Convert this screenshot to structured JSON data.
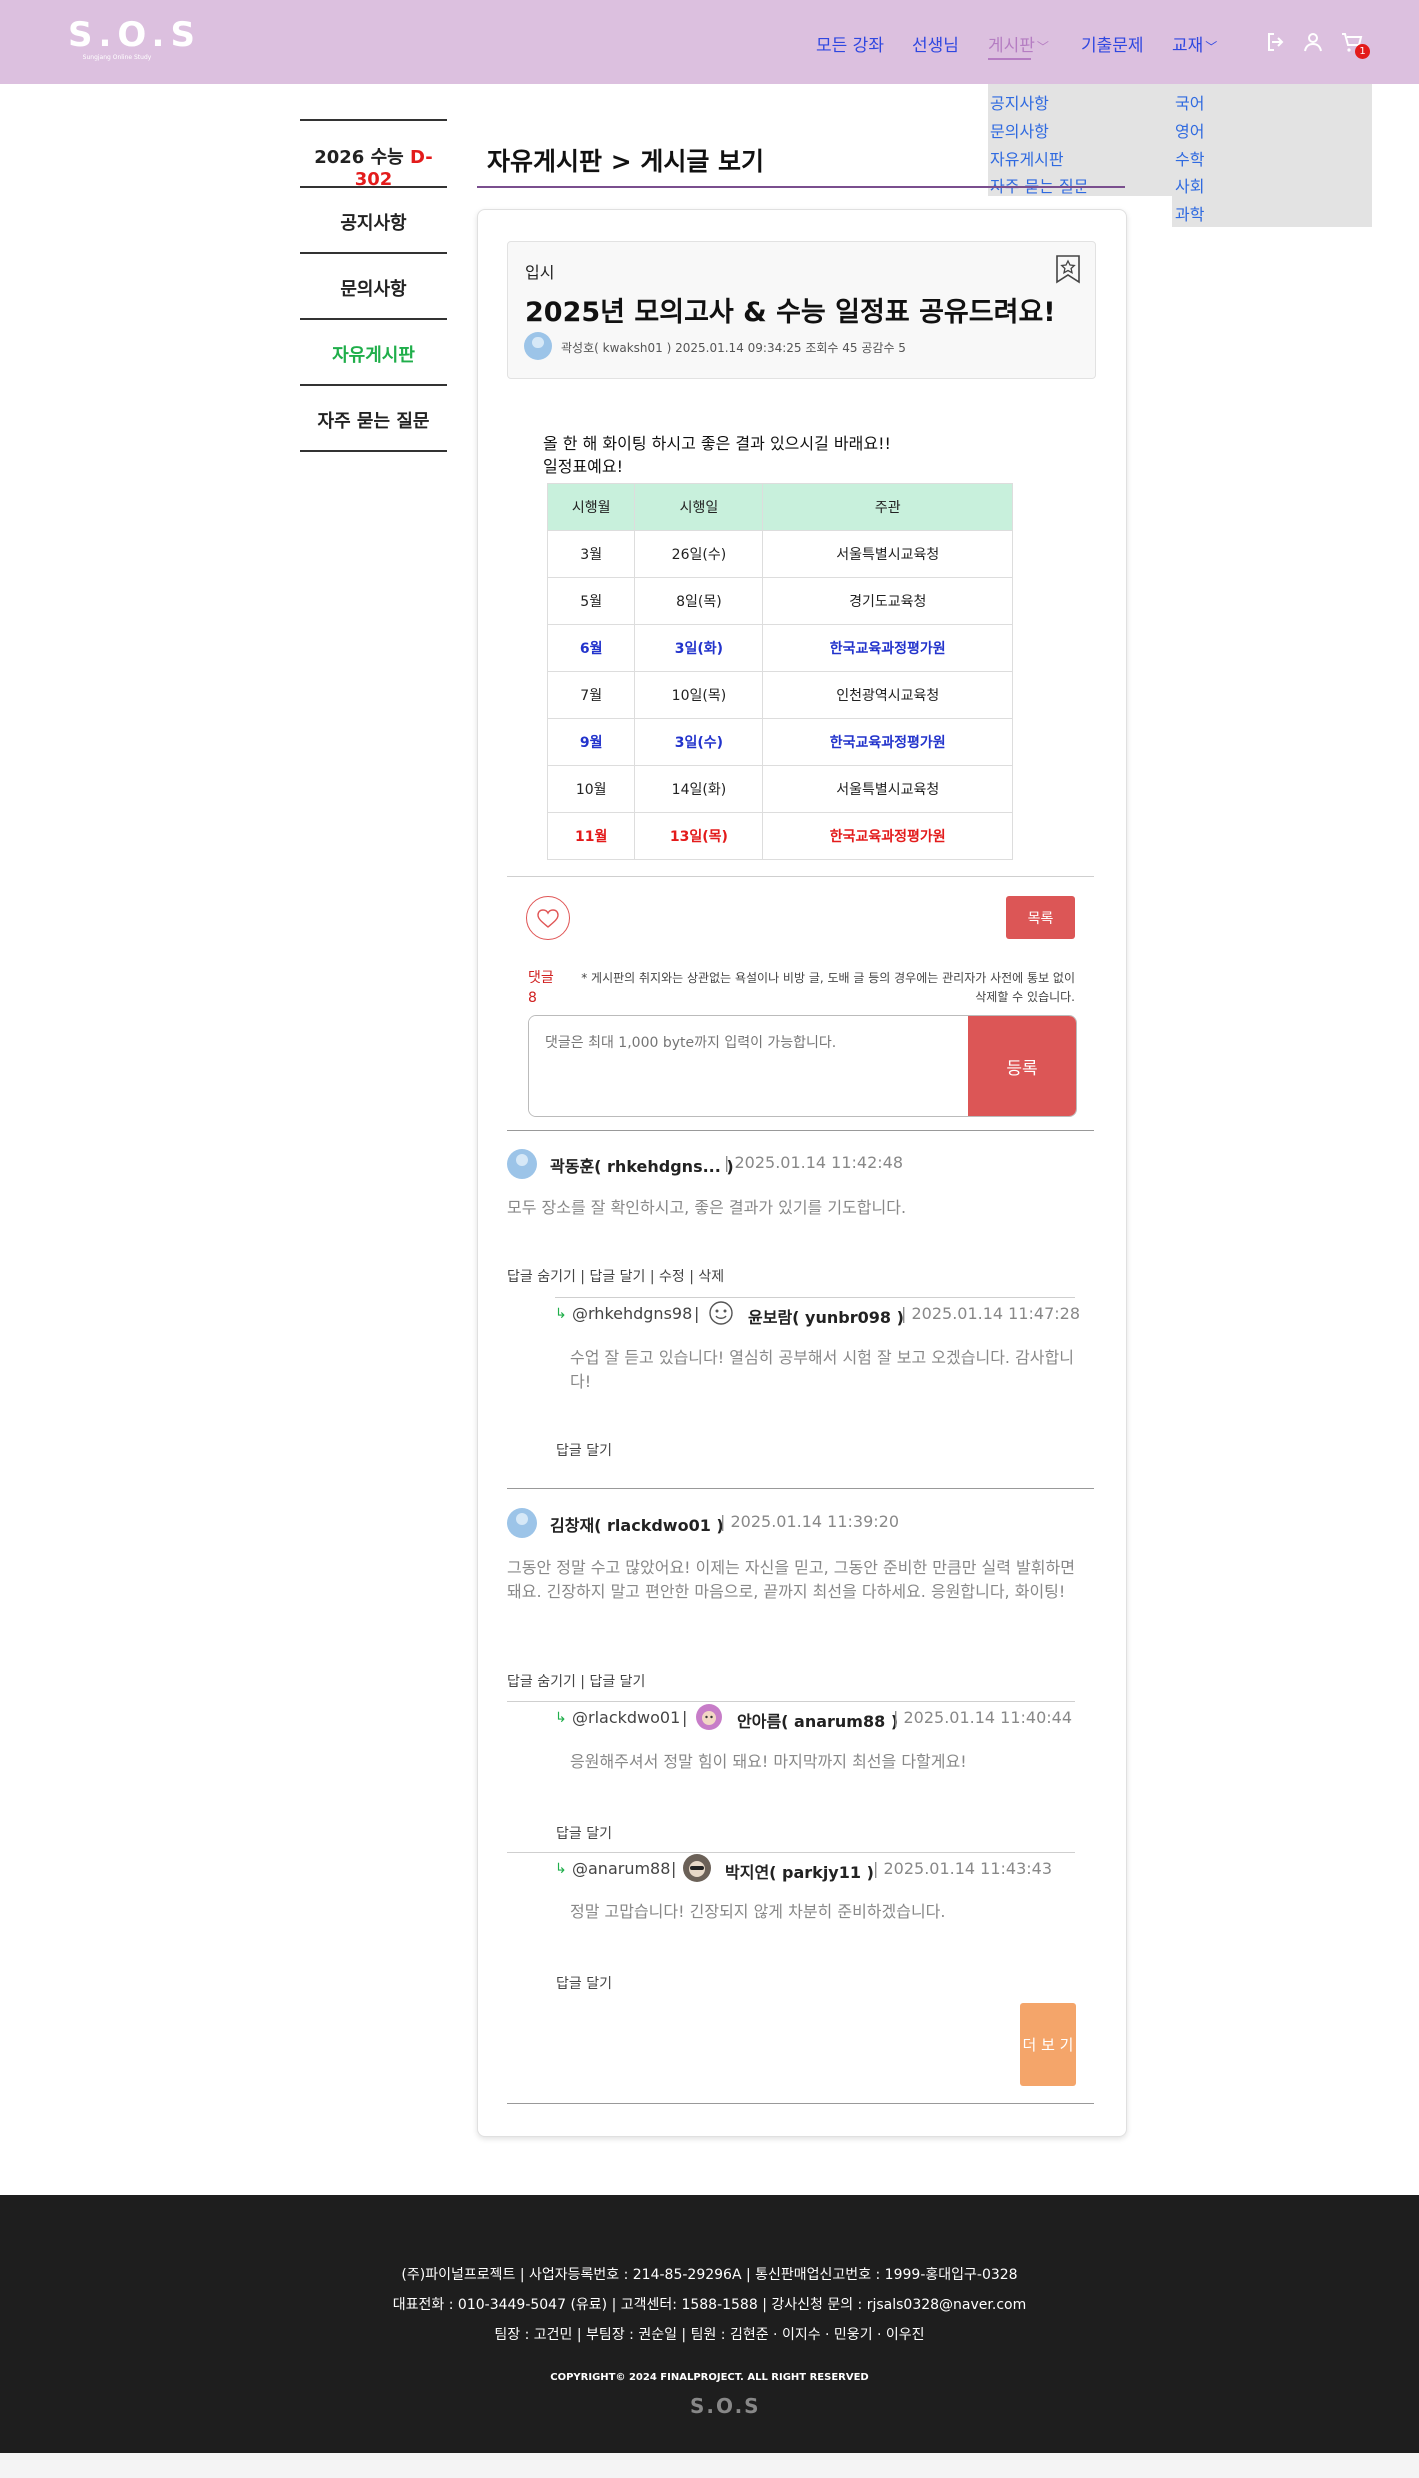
{
  "header": {
    "logo_text": "S.O.S",
    "logo_sub": "Sungjang Online Study",
    "nav": [
      "모든 강좌",
      "선생님",
      "게시판",
      "기출문제",
      "교재"
    ],
    "cart_count": "1"
  },
  "board_menu": [
    "공지사항",
    "문의사항",
    "자유게시판",
    "자주 묻는 질문"
  ],
  "book_menu": [
    "국어",
    "영어",
    "수학",
    "사회",
    "과학"
  ],
  "sidebar": {
    "dday_prefix": "2026 수능",
    "dday": "D-302",
    "items": [
      "공지사항",
      "문의사항",
      "자유게시판",
      "자주 묻는 질문"
    ]
  },
  "breadcrumb": "자유게시판 > 게시글 보기",
  "post": {
    "category": "입시",
    "title": "2025년 모의고사 & 수능 일정표 공유드려요!",
    "meta": "곽성호( kwaksh01 ) 2025.01.14 09:34:25 조회수 45 공감수 5",
    "line1": "올 한 해 화이팅 하시고 좋은 결과 있으시길 바래요!!",
    "line2": "일정표예요!"
  },
  "schedule": {
    "headers": [
      "시행월",
      "시행일",
      "주관"
    ],
    "rows": [
      [
        "3월",
        "26일(수)",
        "서울특별시교육청"
      ],
      [
        "5월",
        "8일(목)",
        "경기도교육청"
      ],
      [
        "6월",
        "3일(화)",
        "한국교육과정평가원"
      ],
      [
        "7월",
        "10일(목)",
        "인천광역시교육청"
      ],
      [
        "9월",
        "3일(수)",
        "한국교육과정평가원"
      ],
      [
        "10월",
        "14일(화)",
        "서울특별시교육청"
      ],
      [
        "11월",
        "13일(목)",
        "한국교육과정평가원"
      ]
    ]
  },
  "actions": {
    "list_button": "목록",
    "comment_label": "댓글",
    "comment_count": "8",
    "notice": "* 게시판의 취지와는 상관없는 욕설이나 비방 글, 도배 글 등의 경우에는 관리자가 사전에 통보 없이 삭제할 수 있습니다.",
    "placeholder": "댓글은 최대 1,000 byte까지 입력이 가능합니다.",
    "submit": "등록"
  },
  "comments": {
    "c1": {
      "author": "곽동훈( rhkehdgns... )",
      "date": "| 2025.01.14 11:42:48",
      "text": "모두 장소를 잘 확인하시고, 좋은 결과가 있기를 기도합니다.",
      "actions": "답글 숨기기 | 답글 달기 | 수정 | 삭제"
    },
    "r1": {
      "mention": "@rhkehdgns98",
      "author": "윤보람( yunbr098 )",
      "date": "| 2025.01.14 11:47:28",
      "text": "수업 잘 듣고 있습니다! 열심히 공부해서 시험 잘 보고 오겠습니다. 감사합니다!",
      "actions": "답글 달기"
    },
    "c2": {
      "author": "김창재( rlackdwo01 )",
      "date": "| 2025.01.14 11:39:20",
      "text": "그동안 정말 수고 많았어요! 이제는 자신을 믿고, 그동안 준비한 만큼만 실력 발휘하면 돼요. 긴장하지 말고 편안한 마음으로, 끝까지 최선을 다하세요. 응원합니다, 화이팅!",
      "actions": "답글 숨기기 | 답글 달기"
    },
    "r2": {
      "mention": "@rlackdwo01",
      "author": "안아름( anarum88 )",
      "date": "| 2025.01.14 11:40:44",
      "text": "응원해주셔서 정말 힘이 돼요! 마지막까지 최선을 다할게요!",
      "actions": "답글 달기"
    },
    "r3": {
      "mention": "@anarum88",
      "author": "박지연( parkjy11 )",
      "date": "| 2025.01.14 11:43:43",
      "text": "정말 고맙습니다! 긴장되지 않게 차분히 준비하겠습니다.",
      "actions": "답글 달기"
    },
    "bar": "|",
    "arrow": "↳"
  },
  "more_button": "더 보 기",
  "footer": {
    "line1": "(주)파이널프로젝트 | 사업자등록번호 : 214-85-29296A | 통신판매업신고번호 : 1999-홍대입구-0328",
    "line2": "대표전화 : 010-3449-5047 (유료) | 고객센터: 1588-1588 | 강사신청 문의 : rjsals0328@naver.com",
    "line3": "팀장 : 고건민  |  부팀장 : 권순일  |  팀원 : 김현준 · 이지수 · 민웅기 · 이우진",
    "copyright": "COPYRIGHT© 2024 FINALPROJECT. ALL RIGHT RESERVED",
    "logo_text": "S.O.S"
  },
  "colors": {
    "header_bg": "#dcc0df",
    "nav_link": "#2f47e0",
    "accent_red": "#dc5656",
    "active_green": "#1fae4a",
    "table_header": "#c8f0dc",
    "footer_bg": "#1e1e1e"
  }
}
